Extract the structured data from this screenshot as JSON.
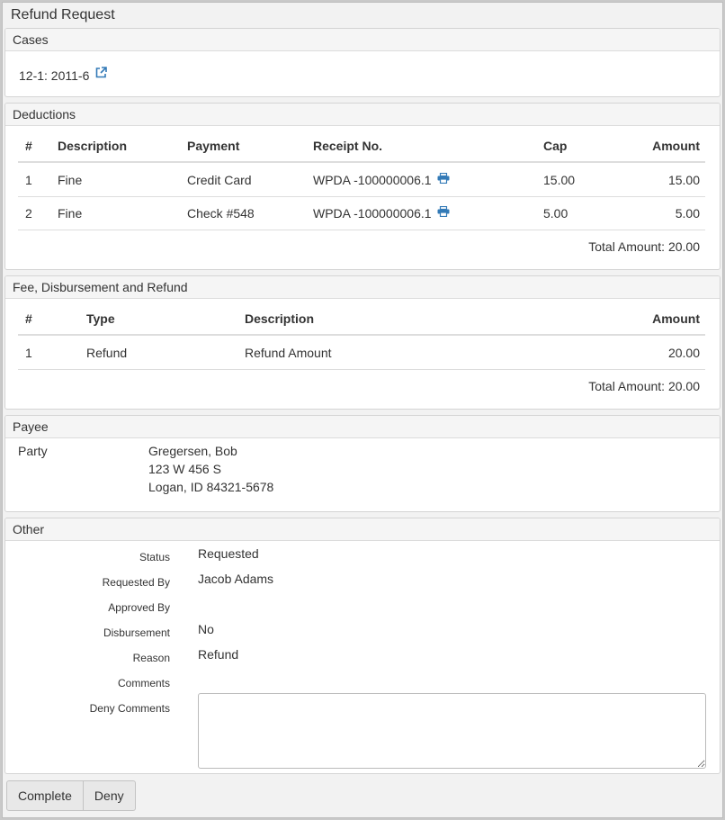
{
  "window": {
    "title": "Refund Request"
  },
  "cases": {
    "heading": "Cases",
    "case_link": "12-1: 2011-6"
  },
  "deductions": {
    "heading": "Deductions",
    "headers": [
      "#",
      "Description",
      "Payment",
      "Receipt No.",
      "Cap",
      "Amount"
    ],
    "rows": [
      {
        "num": "1",
        "description": "Fine",
        "payment": "Credit Card",
        "receipt": "WPDA -100000006.1",
        "cap": "15.00",
        "amount": "15.00"
      },
      {
        "num": "2",
        "description": "Fine",
        "payment": "Check #548",
        "receipt": "WPDA -100000006.1",
        "cap": "5.00",
        "amount": "5.00"
      }
    ],
    "total": "Total Amount: 20.00"
  },
  "fees": {
    "heading": "Fee, Disbursement and Refund",
    "headers": [
      "#",
      "Type",
      "Description",
      "Amount"
    ],
    "rows": [
      {
        "num": "1",
        "type": "Refund",
        "description": "Refund Amount",
        "amount": "20.00"
      }
    ],
    "total": "Total Amount: 20.00"
  },
  "payee": {
    "heading": "Payee",
    "label": "Party",
    "name": "Gregersen, Bob",
    "address1": "123 W 456 S",
    "address2": "Logan, ID 84321-5678"
  },
  "other": {
    "heading": "Other",
    "status_label": "Status",
    "status_value": "Requested",
    "requested_by_label": "Requested By",
    "requested_by_value": "Jacob Adams",
    "approved_by_label": "Approved By",
    "approved_by_value": "",
    "disbursement_label": "Disbursement",
    "disbursement_value": "No",
    "reason_label": "Reason",
    "reason_value": "Refund",
    "comments_label": "Comments",
    "comments_value": "",
    "deny_comments_label": "Deny Comments",
    "deny_comments_value": ""
  },
  "actions": {
    "complete": "Complete",
    "deny": "Deny"
  },
  "colors": {
    "link": "#337ab7",
    "panel_head": "#f5f5f5"
  },
  "icons": {
    "external_link": "external-link-icon",
    "print": "print-icon"
  }
}
